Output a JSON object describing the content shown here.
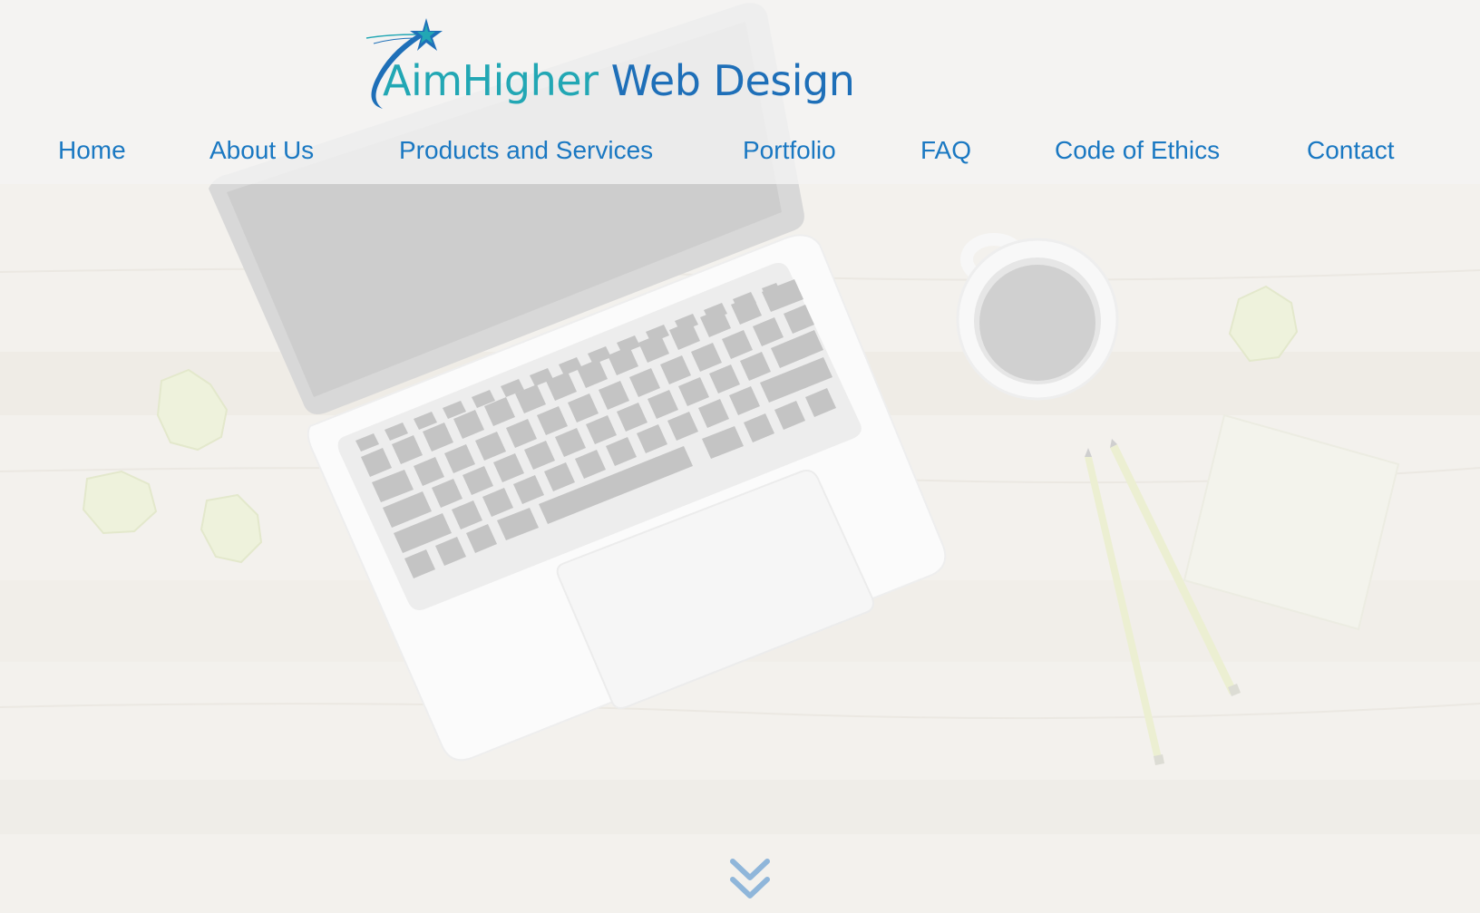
{
  "brand": {
    "name_part1": "AimHigher",
    "name_part2": " Web Design",
    "colors": {
      "teal": "#22a7b4",
      "blue": "#1e6fb8",
      "nav": "#1a78c2"
    }
  },
  "nav": {
    "items": [
      {
        "label": "Home"
      },
      {
        "label": "About Us"
      },
      {
        "label": "Products and Services"
      },
      {
        "label": "Portfolio"
      },
      {
        "label": "FAQ"
      },
      {
        "label": "Code of Ethics"
      },
      {
        "label": "Contact"
      }
    ]
  },
  "hero": {
    "scene": "laptop-coffee-pencils-desk",
    "scroll_icon": "double-chevron-down-icon"
  }
}
